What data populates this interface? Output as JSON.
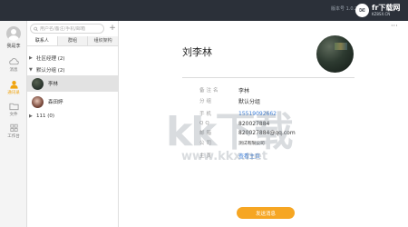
{
  "titlebar": {
    "version": "版本号 1.0.2",
    "brand_name": "fr下载网",
    "brand_url": "KZ8SX.CN"
  },
  "sidebar": {
    "username": "我是李",
    "items": [
      {
        "label": "消息",
        "icon": "cloud-icon"
      },
      {
        "label": "通讯录",
        "icon": "contacts-icon"
      },
      {
        "label": "文件",
        "icon": "folder-icon"
      },
      {
        "label": "工作台",
        "icon": "grid-icon"
      }
    ]
  },
  "contacts": {
    "search_placeholder": "用户名/备注/手机/邮箱",
    "add_label": "+",
    "tabs": [
      "联系人",
      "群组",
      "组织架构"
    ],
    "groups": [
      {
        "caret": "▶",
        "label": "社区经理 (2)"
      },
      {
        "caret": "▼",
        "label": "默认分组 (2)"
      },
      {
        "caret": "▶",
        "label": "111 (0)"
      }
    ],
    "members": [
      {
        "name": "李林"
      },
      {
        "name": "森田婷"
      }
    ]
  },
  "profile": {
    "more_label": "···",
    "name": "刘李林",
    "fields": [
      {
        "key": "备注名",
        "value": "李林"
      },
      {
        "key": "分组",
        "value": "默认分组"
      },
      {
        "key": "手机",
        "value": "15519092662"
      },
      {
        "key": "QQ",
        "value": "820027884"
      },
      {
        "key": "邮箱",
        "value": "820027884@qq.com"
      },
      {
        "key": "公司",
        "value": "测试有限公司"
      },
      {
        "key": "主页",
        "value": "查看主页"
      }
    ],
    "send_label": "发送消息"
  },
  "watermark": {
    "text": "kk下载",
    "url": "www.kkx.net"
  },
  "colors": {
    "titlebar": "#2b3039",
    "accent": "#f6a623",
    "link": "#3b7dd8"
  }
}
